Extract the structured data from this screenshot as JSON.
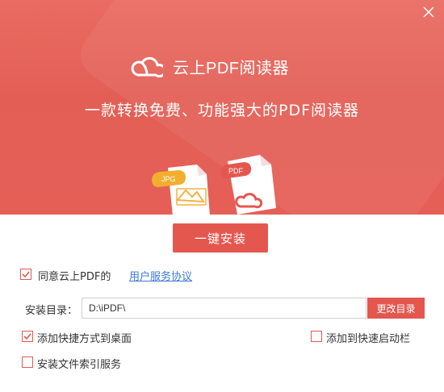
{
  "app": {
    "name": "云上PDF阅读器",
    "slogan": "一款转换免费、功能强大的PDF阅读器"
  },
  "illustration": {
    "file1_label": "JPG",
    "file2_label": "PDF"
  },
  "install_button": {
    "label": "一键安装"
  },
  "agreement": {
    "checked": true,
    "text": "同意云上PDF的",
    "link_text": "用户服务协议"
  },
  "install_dir": {
    "label": "安装目录：",
    "value": "D:\\iPDF\\",
    "change_button": "更改目录"
  },
  "options": {
    "desktop_shortcut": {
      "label": "添加快捷方式到桌面",
      "checked": true
    },
    "quick_launch": {
      "label": "添加到快速启动栏",
      "checked": false
    },
    "file_index": {
      "label": "安装文件索引服务",
      "checked": false
    }
  },
  "colors": {
    "accent": "#e4574f",
    "hero_top": "#e96b61",
    "link": "#3c7ad3"
  },
  "icons": [
    "close-icon",
    "cloud-logo-icon",
    "jpg-file-icon",
    "pdf-file-icon",
    "check-icon"
  ]
}
